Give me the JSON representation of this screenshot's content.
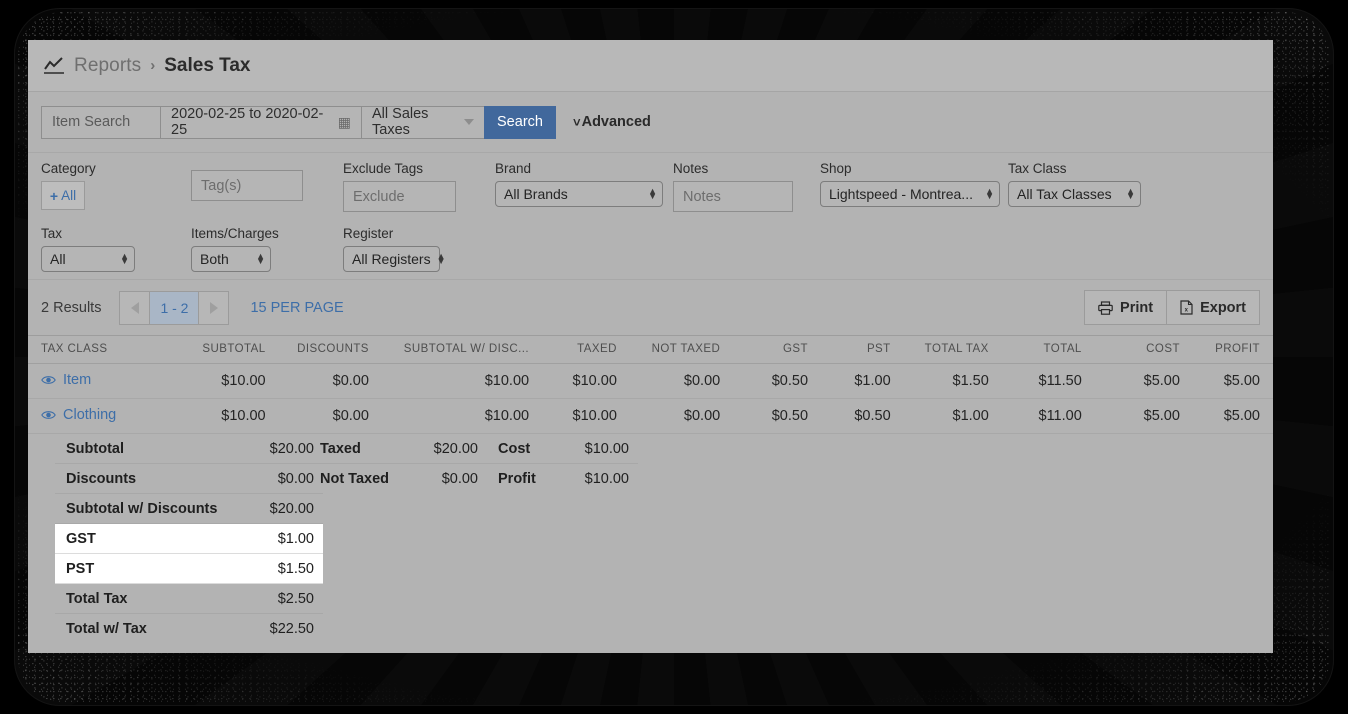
{
  "header": {
    "chart_icon": "line-chart-icon",
    "breadcrumb_root": "Reports",
    "breadcrumb_sep": "›",
    "breadcrumb_current": "Sales Tax"
  },
  "search": {
    "item_search_placeholder": "Item Search",
    "date_range_value": "2020-02-25 to 2020-02-25",
    "calendar_icon": "calendar-icon",
    "tax_select_value": "All Sales Taxes",
    "search_button": "Search",
    "advanced_label": "Advanced",
    "advanced_chevron": "˅"
  },
  "filters": {
    "category_label": "Category",
    "category_all_button": "All",
    "category_plus": "+",
    "tags_placeholder": "Tag(s)",
    "exclude_tags_label": "Exclude Tags",
    "exclude_tags_placeholder": "Exclude",
    "brand_label": "Brand",
    "brand_value": "All Brands",
    "notes_label": "Notes",
    "notes_placeholder": "Notes",
    "shop_label": "Shop",
    "shop_value": "Lightspeed - Montrea...",
    "tax_class_label": "Tax Class",
    "tax_class_value": "All Tax Classes",
    "tax_label": "Tax",
    "tax_value": "All",
    "items_charges_label": "Items/Charges",
    "items_charges_value": "Both",
    "register_label": "Register",
    "register_value": "All Registers"
  },
  "toolbar": {
    "results_count": "2 Results",
    "page_prev": "prev-page-icon",
    "page_current": "1 - 2",
    "page_next": "next-page-icon",
    "per_page": "15 PER PAGE",
    "print_label": "Print",
    "export_label": "Export"
  },
  "table": {
    "columns": [
      "TAX CLASS",
      "SUBTOTAL",
      "DISCOUNTS",
      "SUBTOTAL W/ DISC...",
      "TAXED",
      "NOT TAXED",
      "GST",
      "PST",
      "TOTAL TAX",
      "TOTAL",
      "COST",
      "PROFIT"
    ],
    "rows": [
      {
        "tax_class": "Item",
        "subtotal": "$10.00",
        "discounts": "$0.00",
        "subtotal_w_disc": "$10.00",
        "taxed": "$10.00",
        "not_taxed": "$0.00",
        "gst": "$0.50",
        "pst": "$1.00",
        "total_tax": "$1.50",
        "total": "$11.50",
        "cost": "$5.00",
        "profit": "$5.00"
      },
      {
        "tax_class": "Clothing",
        "subtotal": "$10.00",
        "discounts": "$0.00",
        "subtotal_w_disc": "$10.00",
        "taxed": "$10.00",
        "not_taxed": "$0.00",
        "gst": "$0.50",
        "pst": "$0.50",
        "total_tax": "$1.00",
        "total": "$11.00",
        "cost": "$5.00",
        "profit": "$5.00"
      }
    ]
  },
  "summary": {
    "col1": [
      {
        "label": "Subtotal",
        "value": "$20.00",
        "highlight": false
      },
      {
        "label": "Discounts",
        "value": "$0.00",
        "highlight": false
      },
      {
        "label": "Subtotal w/ Discounts",
        "value": "$20.00",
        "highlight": false
      },
      {
        "label": "GST",
        "value": "$1.00",
        "highlight": true
      },
      {
        "label": "PST",
        "value": "$1.50",
        "highlight": true
      },
      {
        "label": "Total Tax",
        "value": "$2.50",
        "highlight": false
      },
      {
        "label": "Total w/ Tax",
        "value": "$22.50",
        "highlight": false
      }
    ],
    "col2": [
      {
        "label": "Taxed",
        "value": "$20.00"
      },
      {
        "label": "Not Taxed",
        "value": "$0.00"
      }
    ],
    "col3": [
      {
        "label": "Cost",
        "value": "$10.00"
      },
      {
        "label": "Profit",
        "value": "$10.00"
      }
    ]
  },
  "colors": {
    "accent_blue": "#3d6ea8",
    "search_button_blue": "#41689c",
    "panel_gray": "#b3b3b3",
    "highlight_white": "#ffffff"
  }
}
